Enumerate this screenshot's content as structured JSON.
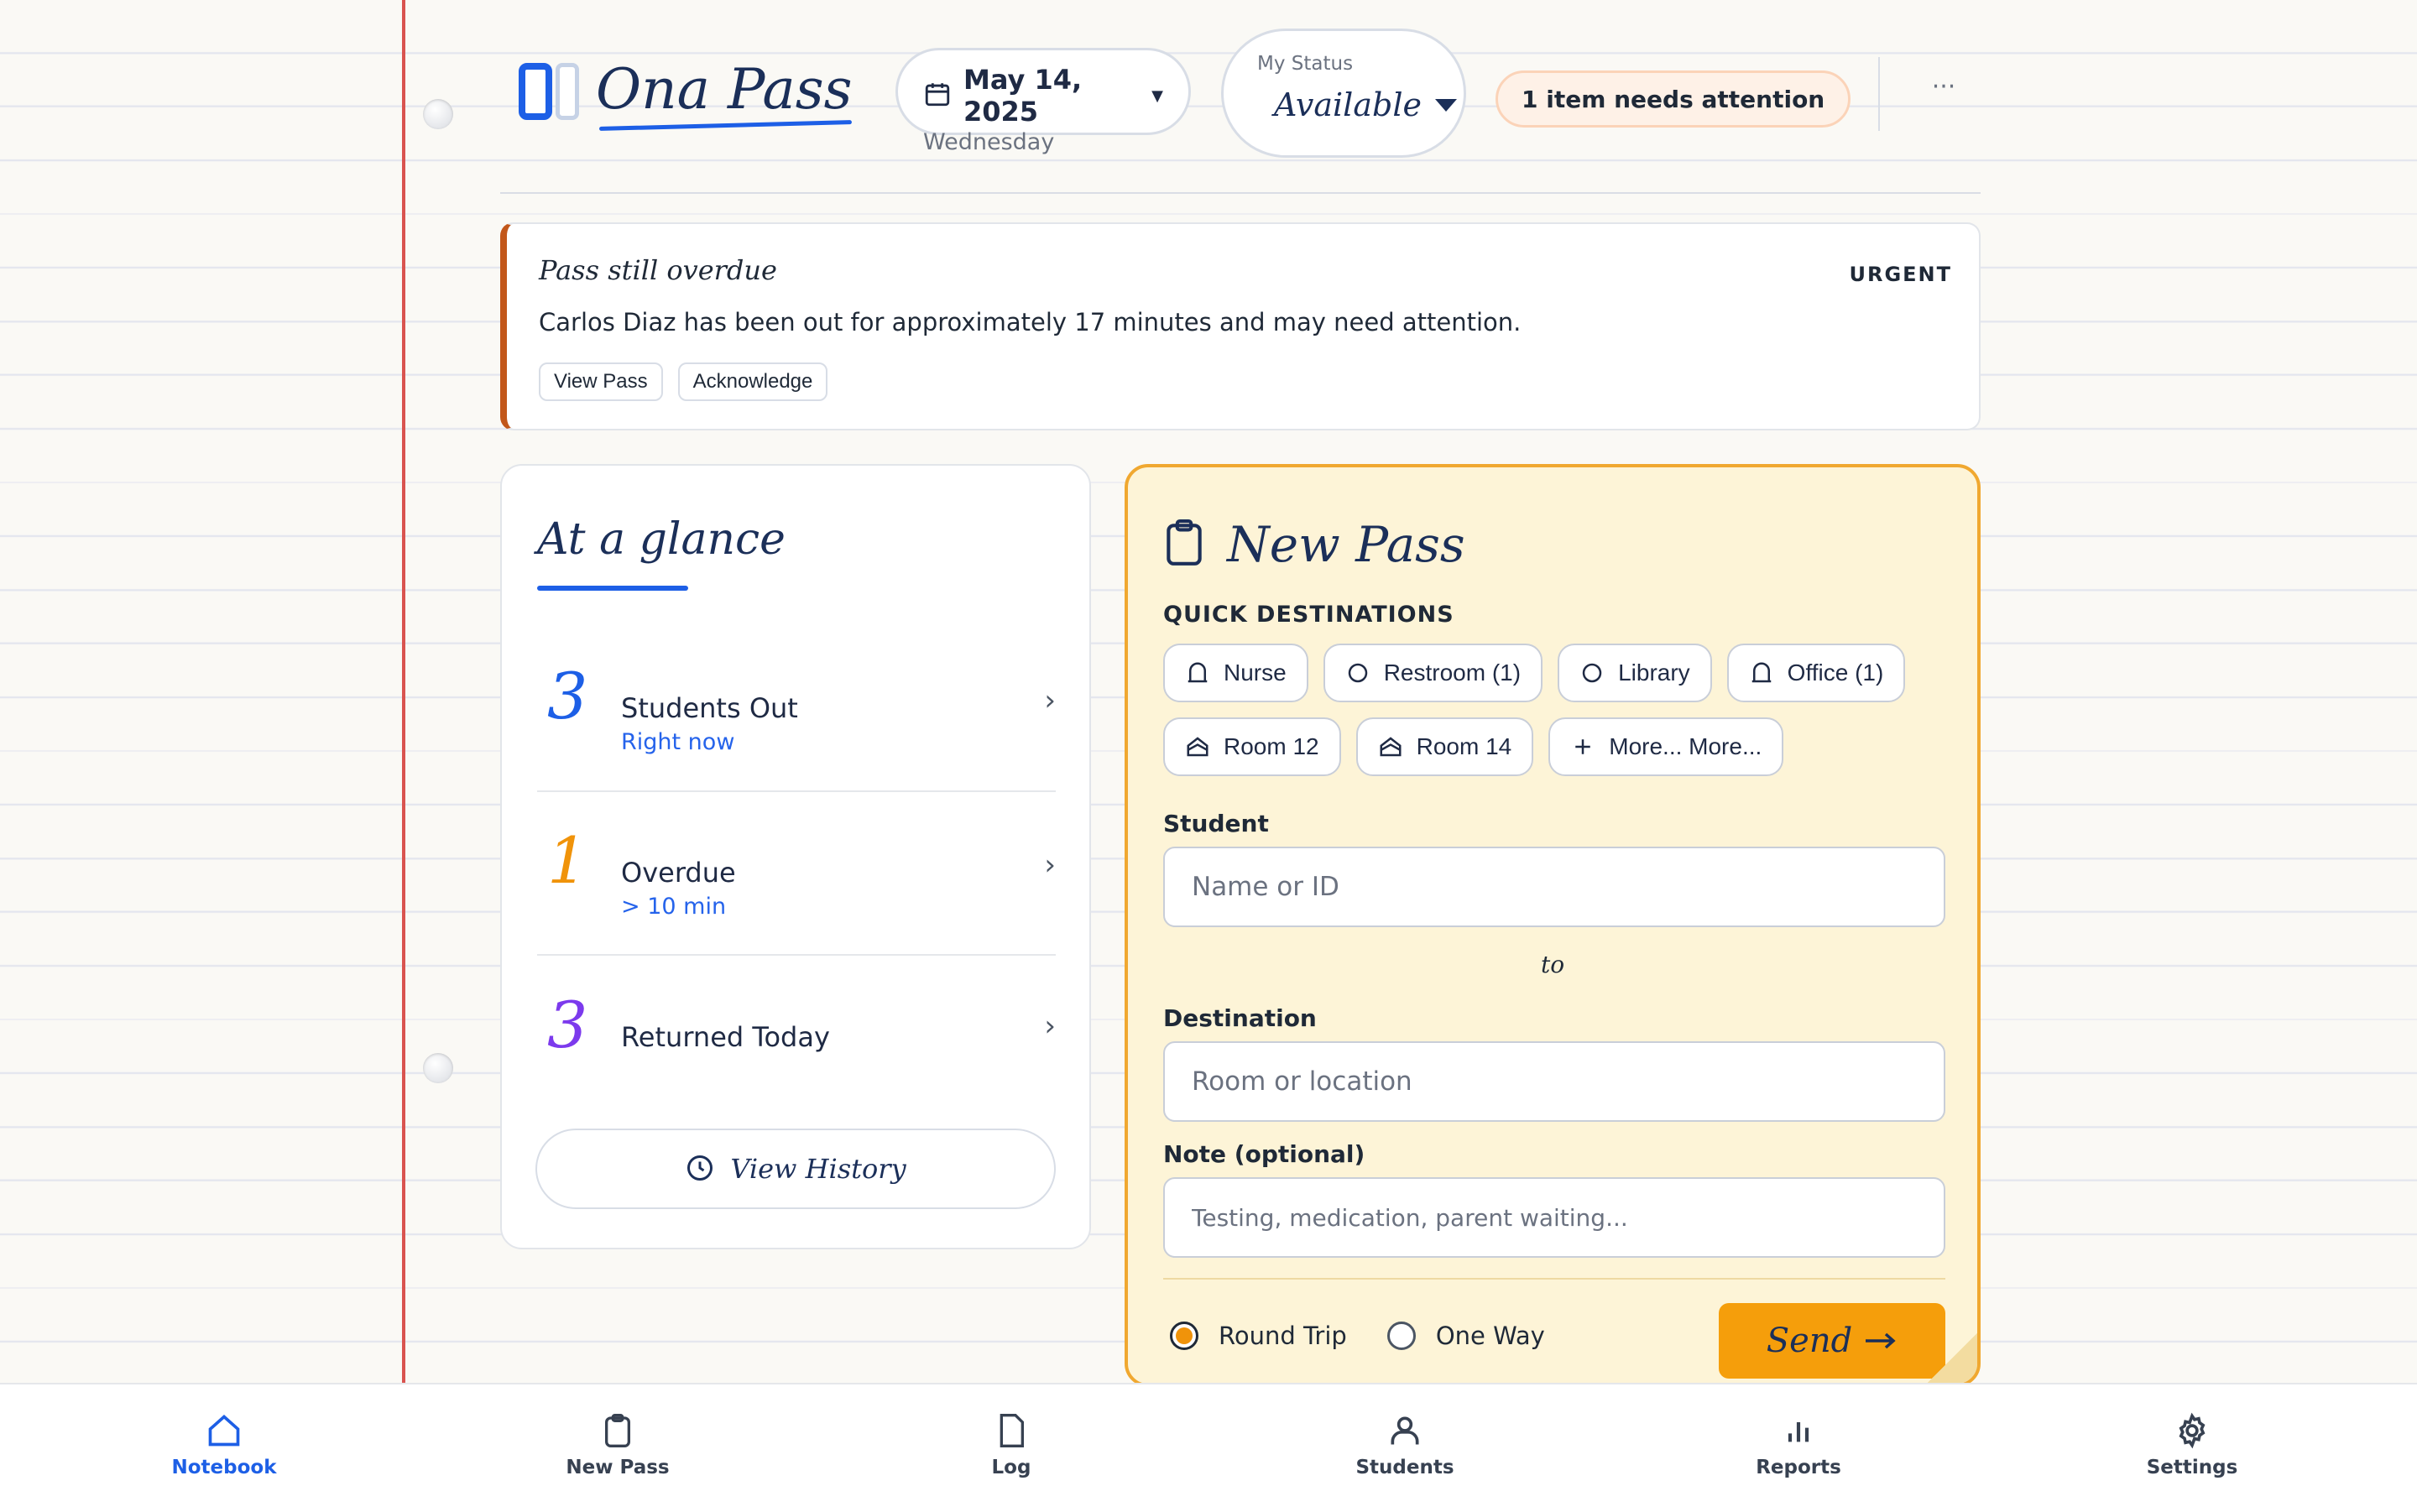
{
  "app": {
    "name": "Ona Pass"
  },
  "header": {
    "date": "May 14, 2025",
    "weekday": "Wednesday",
    "status_label": "My Status",
    "status_value": "Available",
    "attention": "1 item needs attention",
    "more": "···"
  },
  "alert": {
    "title": "Pass still overdue",
    "tag": "URGENT",
    "message": "Carlos Diaz has been out for approximately 17 minutes and may need attention.",
    "actions": [
      "View Pass",
      "Acknowledge"
    ],
    "accent": "#c2571a"
  },
  "glance": {
    "title": "At a glance",
    "stats": [
      {
        "value": "3",
        "label": "Students Out",
        "sub": "Right now",
        "color": "#1d5fe6"
      },
      {
        "value": "1",
        "label": "Overdue",
        "sub": "> 10 min",
        "color": "#f0930a"
      },
      {
        "value": "3",
        "label": "Returned Today",
        "sub": "",
        "color": "#7c3aed"
      }
    ],
    "history_label": "View History"
  },
  "new_pass": {
    "title": "New Pass",
    "quick_label": "QUICK DESTINATIONS",
    "destinations": [
      {
        "label": "Nurse",
        "icon": "bell-icon"
      },
      {
        "label": "Restroom (1)",
        "icon": "circle-icon"
      },
      {
        "label": "Library",
        "icon": "circle-icon"
      },
      {
        "label": "Office (1)",
        "icon": "bell-icon"
      },
      {
        "label": "Room 12",
        "icon": "room-icon"
      },
      {
        "label": "Room 14",
        "icon": "room-icon"
      },
      {
        "label": "More...  More...",
        "icon": "plus-icon"
      }
    ],
    "student_label": "Student",
    "student_placeholder": "Name or ID",
    "to_label": "to",
    "destination_label": "Destination",
    "destination_placeholder": "Room or location",
    "note_label": "Note (optional)",
    "note_placeholder": "Testing, medication, parent waiting...",
    "trip_options": [
      "Round Trip",
      "One Way"
    ],
    "trip_selected": "Round Trip",
    "send_label": "Send"
  },
  "nav": {
    "items": [
      {
        "label": "Notebook",
        "icon": "home-icon",
        "active": true
      },
      {
        "label": "New Pass",
        "icon": "clipboard-icon",
        "active": false
      },
      {
        "label": "Log",
        "icon": "file-icon",
        "active": false
      },
      {
        "label": "Students",
        "icon": "user-icon",
        "active": false
      },
      {
        "label": "Reports",
        "icon": "bar-chart-icon",
        "active": false
      },
      {
        "label": "Settings",
        "icon": "gear-icon",
        "active": false
      }
    ]
  },
  "colors": {
    "brand": "#1d5fe6",
    "accent": "#f59e0b",
    "status_ok": "#16a34a"
  }
}
